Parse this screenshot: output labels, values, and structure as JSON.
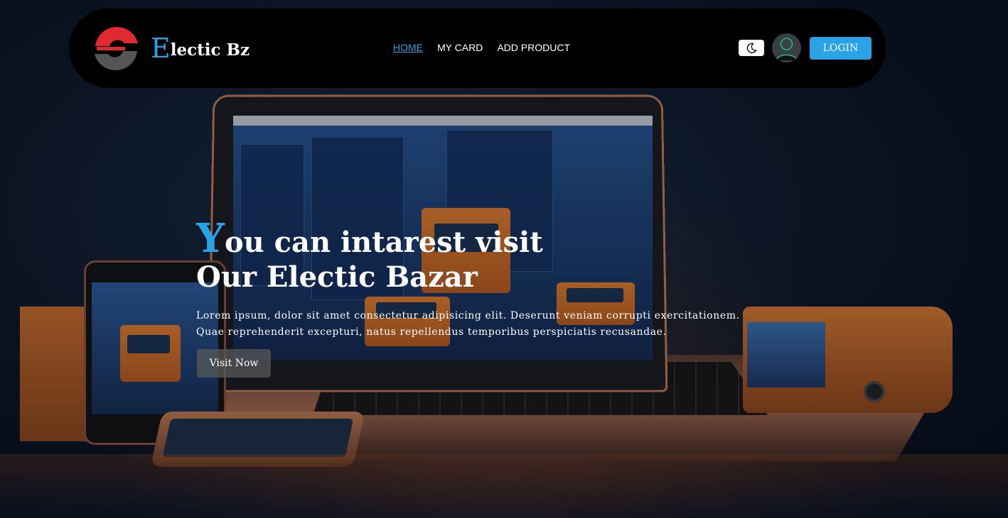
{
  "brand": {
    "initial": "E",
    "rest": "lectic Bz"
  },
  "nav": {
    "links": [
      {
        "label": "HOME",
        "active": true
      },
      {
        "label": "MY CARD",
        "active": false
      },
      {
        "label": "ADD PRODUCT",
        "active": false
      }
    ],
    "login_label": "LOGIN"
  },
  "icons": {
    "logo": "logo-icon",
    "mode_toggle": "moon-icon",
    "avatar": "user-avatar-icon"
  },
  "hero": {
    "title_initial": "Y",
    "title_line1_rest": "ou can intarest visit",
    "title_line2": "Our Electic Bazar",
    "description_line1": "Lorem ipsum, dolor sit amet consectetur adipisicing elit. Deserunt veniam corrupti exercitationem.",
    "description_line2": "Quae reprehenderit excepturi, natus repellendus temporibus perspiciatis recusandae.",
    "cta_label": "Visit Now"
  },
  "colors": {
    "accent": "#2aa3e6",
    "navbar_bg": "#000000",
    "logo_red": "#e02a30",
    "logo_gray": "#555555"
  }
}
